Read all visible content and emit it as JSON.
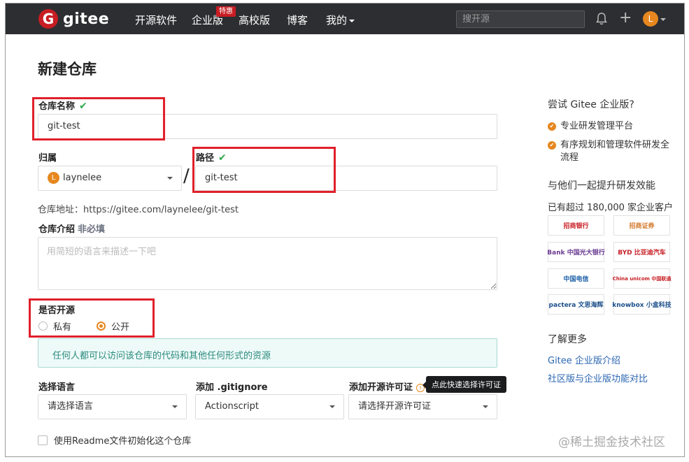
{
  "nav": {
    "logo_letter": "G",
    "logo_text": "gitee",
    "items": [
      "开源软件",
      "企业版",
      "高校版",
      "博客",
      "我的"
    ],
    "badge": "特惠",
    "search_placeholder": "搜开源",
    "avatar_letter": "L"
  },
  "page_title": "新建仓库",
  "form": {
    "repo_name_label": "仓库名称",
    "repo_name_value": "git-test",
    "owner_label": "归属",
    "owner_value": "laynelee",
    "owner_avatar_letter": "L",
    "slash": "/",
    "path_label": "路径",
    "path_value": "git-test",
    "check_mark": "✔",
    "address_hint": "仓库地址：https://gitee.com/laynelee/git-test",
    "desc_label": "仓库介绍",
    "desc_optional": "非必填",
    "desc_placeholder": "用简短的语言来描述一下吧",
    "open_source_label": "是否开源",
    "visibility_private": "私有",
    "visibility_public": "公开",
    "visibility_selected": "公开",
    "public_info": "任何人都可以访问该仓库的代码和其他任何形式的资源",
    "language_label": "选择语言",
    "language_value": "请选择语言",
    "gitignore_label": "添加 .gitignore",
    "gitignore_value": "Actionscript",
    "license_label": "添加开源许可证",
    "license_info_icon": "i",
    "license_value": "请选择开源许可证",
    "license_tooltip": "点此快速选择许可证",
    "readme_label": "使用Readme文件初始化这个仓库"
  },
  "sidebar": {
    "try_title": "尝试 Gitee 企业版?",
    "features": [
      "专业研发管理平台",
      "有序规划和管理软件研发全",
      "流程"
    ],
    "bullet_mark": "✔",
    "together_title": "与他们一起提升研发效能",
    "customers": "已有超过 180,000 家企业客户",
    "brands": [
      {
        "name": "招商银行",
        "color": "#c71d23"
      },
      {
        "name": "招商证券",
        "color": "#d4782a"
      },
      {
        "name": "Bank 中国光大银行",
        "color": "#6a3a91"
      },
      {
        "name": "BYD 比亚迪汽车",
        "color": "#c71d23"
      },
      {
        "name": "中国电信",
        "color": "#1a5fa8"
      },
      {
        "name": "China unicom 中国联通",
        "color": "#c71d23"
      },
      {
        "name": "pactera 文思海辉",
        "color": "#1b4f8a"
      },
      {
        "name": "knowbox 小盒科技",
        "color": "#1b4f8a"
      }
    ],
    "learn_more": "了解更多",
    "links": [
      "Gitee 企业版介绍",
      "社区版与企业版功能对比"
    ]
  },
  "watermark": "@稀土掘金技术社区",
  "colors": {
    "accent": "#e6871f",
    "nav_bg": "#2d2e31",
    "highlight": "#e0202a",
    "link": "#2b66b2",
    "info_text": "#2b8a7e"
  }
}
